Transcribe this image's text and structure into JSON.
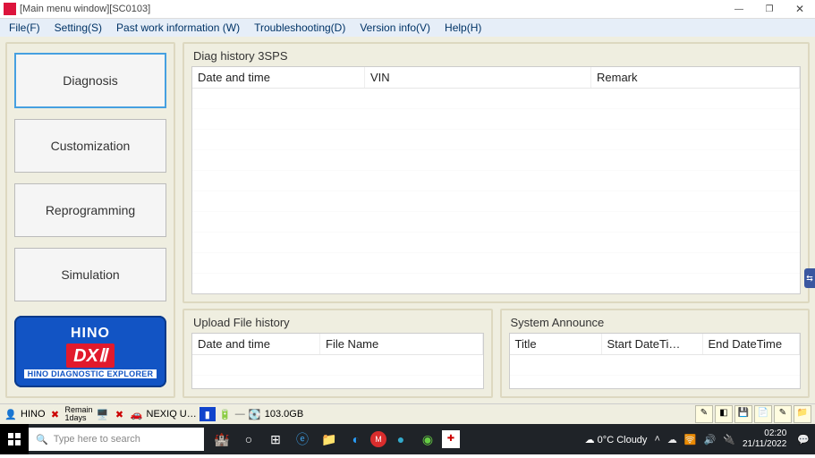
{
  "window": {
    "title": "[Main menu window][SC0103]"
  },
  "menubar": [
    "File(F)",
    "Setting(S)",
    "Past work information (W)",
    "Troubleshooting(D)",
    "Version info(V)",
    "Help(H)"
  ],
  "sidebar": {
    "buttons": [
      "Diagnosis",
      "Customization",
      "Reprogramming",
      "Simulation"
    ],
    "logo": {
      "brand": "HINO",
      "product": "DXⅡ",
      "sub": "HINO DIAGNOSTIC EXPLORER"
    }
  },
  "groups": {
    "diag": {
      "title": "Diag history 3SPS",
      "cols": [
        "Date and time",
        "VIN",
        "Remark"
      ]
    },
    "upload": {
      "title": "Upload File history",
      "cols": [
        "Date and time",
        "File Name"
      ]
    },
    "announce": {
      "title": "System Announce",
      "cols": [
        "Title",
        "Start DateTi…",
        "End DateTime"
      ]
    }
  },
  "statusbar": {
    "hino": "HINO",
    "remain": "Remain",
    "remain2": "1days",
    "nexiq": "NEXIQ U…",
    "disk": "103.0GB"
  },
  "taskbar": {
    "search_placeholder": "Type here to search",
    "weather": "0°C  Cloudy",
    "time": "02:20",
    "date": "21/11/2022"
  }
}
